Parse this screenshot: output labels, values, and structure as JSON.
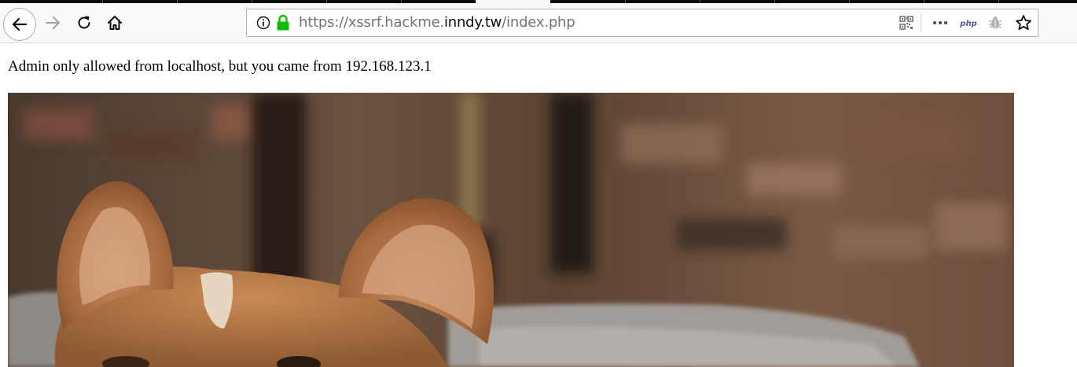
{
  "browser": {
    "url": {
      "scheme": "https://",
      "subdomain": "xssrf.hackme.",
      "host": "inndy.tw",
      "path": "/index.php"
    },
    "toolbar_icons": [
      "back-icon",
      "forward-icon",
      "reload-icon",
      "home-icon",
      "info-icon",
      "lock-icon",
      "qr-code-icon",
      "more-icon",
      "php-icon",
      "bug-icon",
      "bookmark-star-icon"
    ],
    "php_label": "php",
    "colors": {
      "lock": "#12bc00",
      "toolbar_bg": "#f9f9fa"
    }
  },
  "page": {
    "message": "Admin only allowed from localhost, but you came from 192.168.123.1",
    "image": {
      "description": "corgi-photo"
    }
  }
}
